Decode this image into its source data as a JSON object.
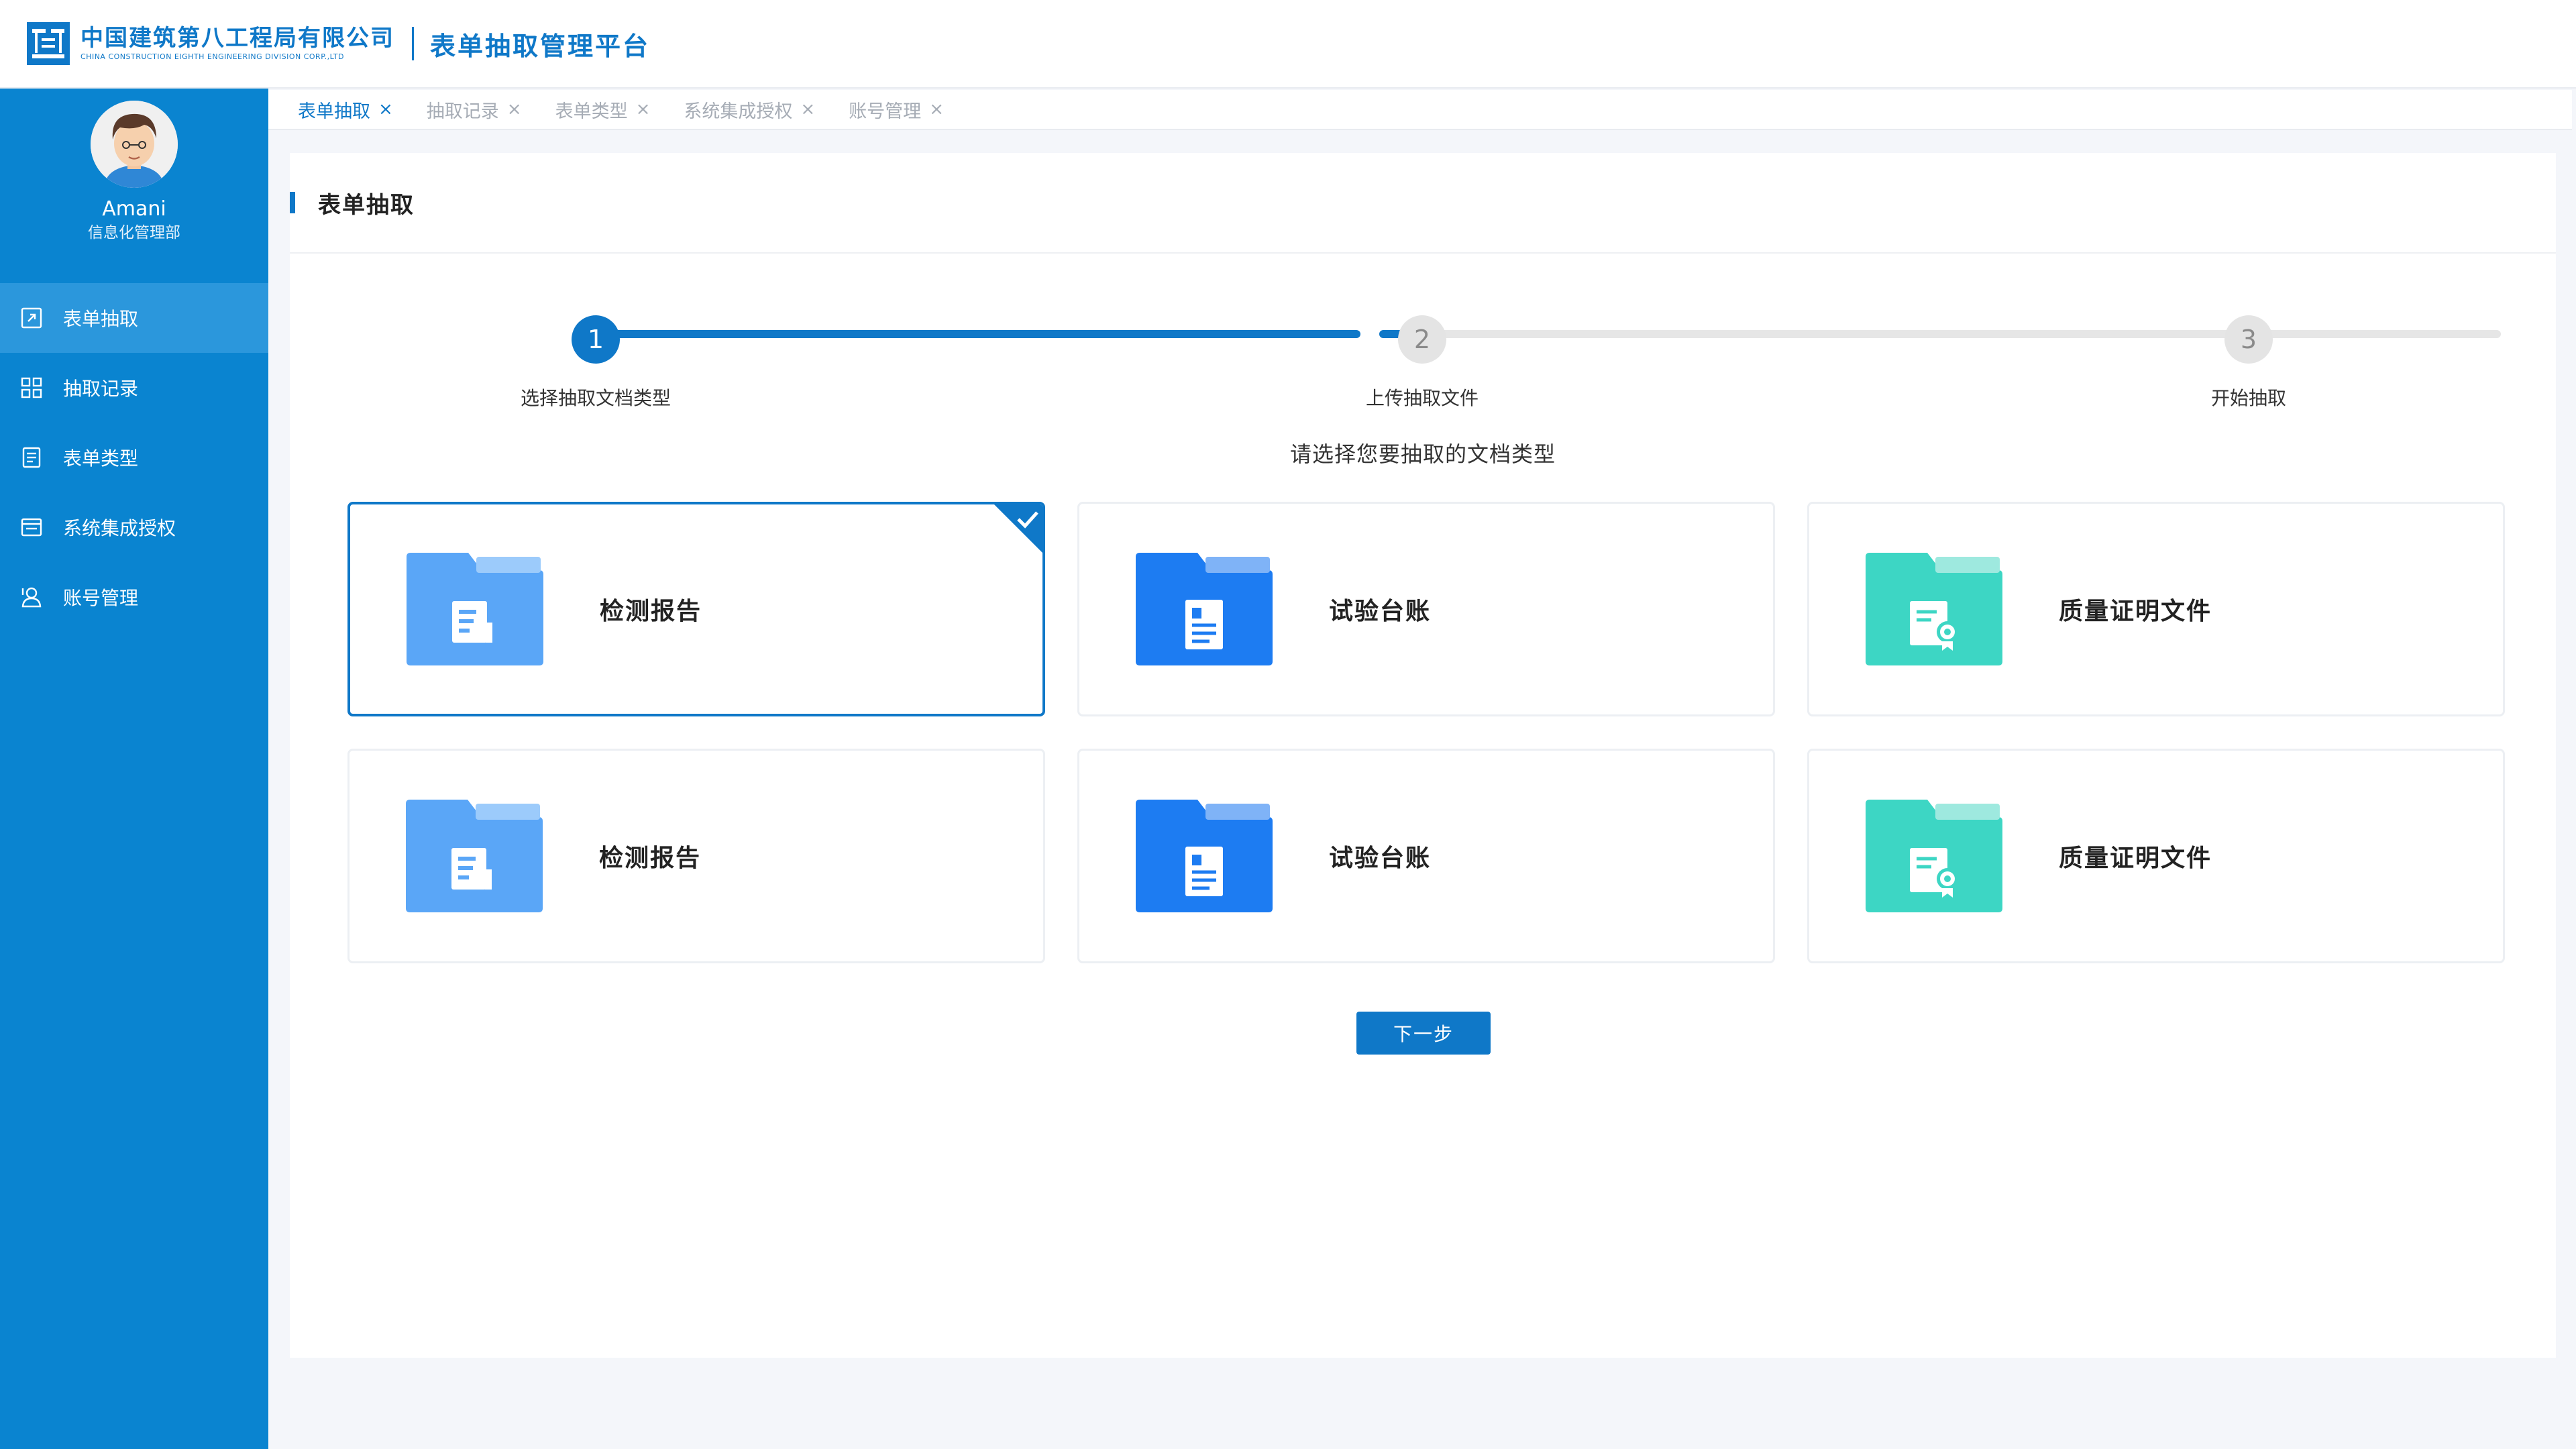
{
  "header": {
    "logo_cn": "中国建筑第八工程局有限公司",
    "logo_en": "CHINA CONSTRUCTION EIGHTH ENGINEERING DIVISION CORP.,LTD",
    "platform_title": "表单抽取管理平台",
    "brand_color": "#0f78c8"
  },
  "user": {
    "name": "Amani",
    "department": "信息化管理部"
  },
  "sidebar": {
    "items": [
      {
        "label": "表单抽取",
        "icon": "form-extract-icon",
        "active": true
      },
      {
        "label": "抽取记录",
        "icon": "grid-icon",
        "active": false
      },
      {
        "label": "表单类型",
        "icon": "document-list-icon",
        "active": false
      },
      {
        "label": "系统集成授权",
        "icon": "window-icon",
        "active": false
      },
      {
        "label": "账号管理",
        "icon": "user-manage-icon",
        "active": false
      }
    ],
    "bg_color": "#0a84d0"
  },
  "tabs": [
    {
      "label": "表单抽取",
      "close": "×",
      "active": true
    },
    {
      "label": "抽取记录",
      "close": "×",
      "active": false
    },
    {
      "label": "表单类型",
      "close": "×",
      "active": false
    },
    {
      "label": "系统集成授权",
      "close": "×",
      "active": false
    },
    {
      "label": "账号管理",
      "close": "×",
      "active": false
    }
  ],
  "panel": {
    "title": "表单抽取"
  },
  "steps": {
    "current": 1,
    "items": [
      {
        "number": "1",
        "label": "选择抽取文档类型"
      },
      {
        "number": "2",
        "label": "上传抽取文件"
      },
      {
        "number": "3",
        "label": "开始抽取"
      }
    ]
  },
  "choose_tip": "请选择您要抽取的文档类型",
  "cards": [
    {
      "label": "检测报告",
      "icon": "folder-report-icon",
      "selected": true
    },
    {
      "label": "试验台账",
      "icon": "folder-ledger-icon",
      "selected": false
    },
    {
      "label": "质量证明文件",
      "icon": "folder-certificate-icon",
      "selected": false
    },
    {
      "label": "检测报告",
      "icon": "folder-report-icon",
      "selected": false
    },
    {
      "label": "试验台账",
      "icon": "folder-ledger-icon",
      "selected": false
    },
    {
      "label": "质量证明文件",
      "icon": "folder-certificate-icon",
      "selected": false
    }
  ],
  "next_button": "下一步",
  "colors": {
    "primary": "#0f78c8",
    "folder_light_blue": "#5aa6f7",
    "folder_blue": "#1d7cf2",
    "folder_teal": "#3dd6c4"
  }
}
